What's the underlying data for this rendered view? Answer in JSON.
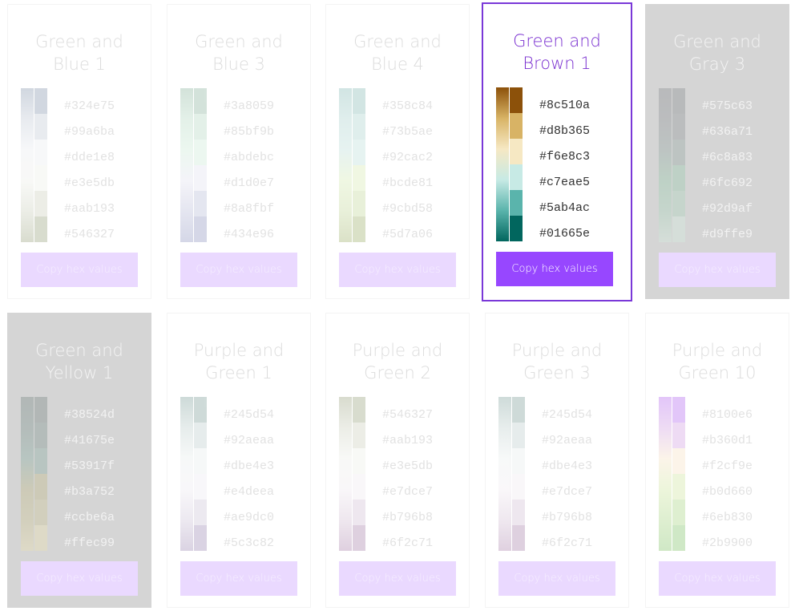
{
  "palettes": [
    {
      "name": "Green and\nBlue 1",
      "line1": "Green and",
      "line2": "Blue 1",
      "state": "faded",
      "colors": [
        "#324e75",
        "#99a6ba",
        "#dde1e8",
        "#e3e5db",
        "#aab193",
        "#546327"
      ],
      "copy_label": "Copy hex values"
    },
    {
      "line1": "Green and",
      "line2": "Blue 3",
      "state": "faded",
      "colors": [
        "#3a8059",
        "#85bf9b",
        "#abdebc",
        "#d1d0e7",
        "#8a8fbf",
        "#434e96"
      ],
      "copy_label": "Copy hex values"
    },
    {
      "line1": "Green and",
      "line2": "Blue 4",
      "state": "faded",
      "colors": [
        "#358c84",
        "#73b5ae",
        "#92cac2",
        "#bcde81",
        "#9cbd58",
        "#5d7a06"
      ],
      "copy_label": "Copy hex values"
    },
    {
      "line1": "Green and",
      "line2": "Brown 1",
      "state": "selected",
      "colors": [
        "#8c510a",
        "#d8b365",
        "#f6e8c3",
        "#c7eae5",
        "#5ab4ac",
        "#01665e"
      ],
      "copy_label": "Copy hex values"
    },
    {
      "line1": "Green and",
      "line2": "Gray 3",
      "state": "gray",
      "colors": [
        "#575c63",
        "#636a71",
        "#6c8a83",
        "#6fc692",
        "#92d9af",
        "#d9ffe9"
      ],
      "copy_label": "Copy hex values"
    },
    {
      "line1": "Green and",
      "line2": "Yellow 1",
      "state": "gray",
      "colors": [
        "#38524d",
        "#41675e",
        "#53917f",
        "#b3a752",
        "#ccbe6a",
        "#ffec99"
      ],
      "copy_label": "Copy hex values"
    },
    {
      "line1": "Purple and",
      "line2": "Green 1",
      "state": "faded",
      "colors": [
        "#245d54",
        "#92aeaa",
        "#dbe4e3",
        "#e4deea",
        "#ae9dc0",
        "#5c3c82"
      ],
      "copy_label": "Copy hex values"
    },
    {
      "line1": "Purple and",
      "line2": "Green 2",
      "state": "faded",
      "colors": [
        "#546327",
        "#aab193",
        "#e3e5db",
        "#e7dce7",
        "#b796b8",
        "#6f2c71"
      ],
      "copy_label": "Copy hex values"
    },
    {
      "line1": "Purple and",
      "line2": "Green 3",
      "state": "faded",
      "colors": [
        "#245d54",
        "#92aeaa",
        "#dbe4e3",
        "#e7dce7",
        "#b796b8",
        "#6f2c71"
      ],
      "copy_label": "Copy hex values"
    },
    {
      "line1": "Purple and",
      "line2": "Green 10",
      "state": "faded",
      "colors": [
        "#8100e6",
        "#b360d1",
        "#f2cf9e",
        "#b0d660",
        "#6eb830",
        "#2b9900"
      ],
      "copy_label": "Copy hex values"
    }
  ],
  "accent_color": "#9747ff",
  "selected_title_color": "#7a30d0"
}
